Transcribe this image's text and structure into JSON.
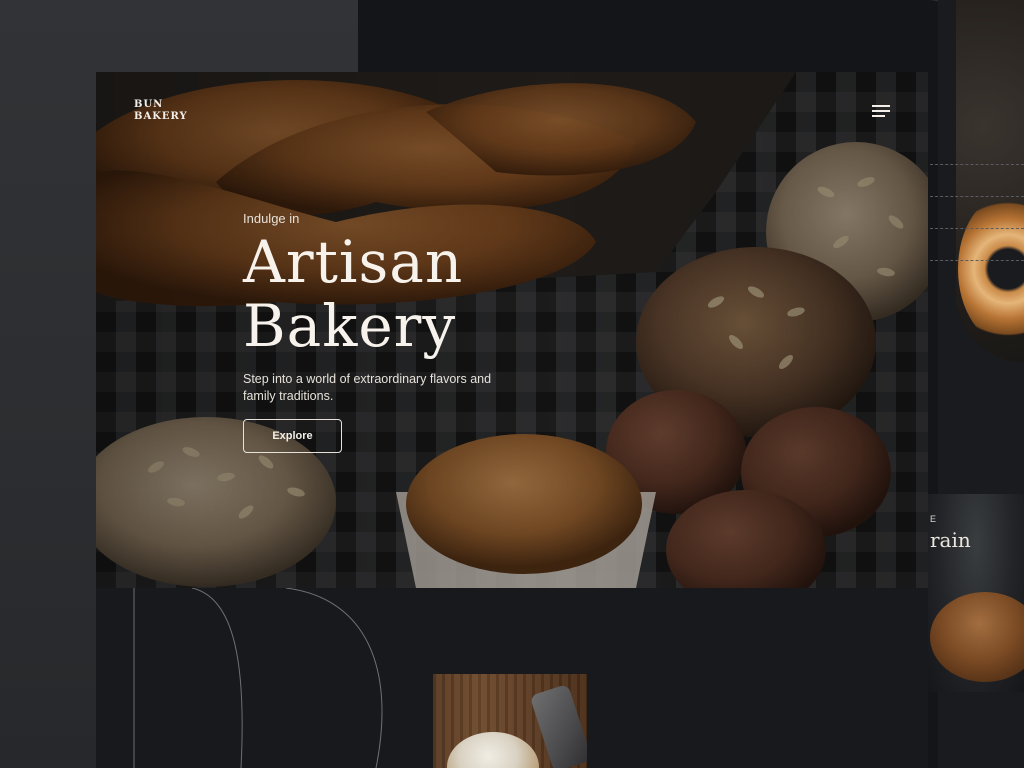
{
  "brand": {
    "line1": "BUN",
    "line2": "BAKERY"
  },
  "nav": {
    "menu_icon": "hamburger-menu-icon"
  },
  "hero": {
    "eyebrow": "Indulge in",
    "title_line1": "Artisan",
    "title_line2": "Bakery",
    "subtitle": "Step into a world of extraordinary flavors and family traditions.",
    "cta_label": "Explore"
  },
  "side_card": {
    "eyebrow": "E",
    "title": "rain"
  },
  "colors": {
    "page_bg": "#2a2c2f",
    "device_bg": "#141518",
    "card_bg": "#18191c",
    "text_primary": "#f7f3ec",
    "text_secondary": "#e6e1d9"
  }
}
